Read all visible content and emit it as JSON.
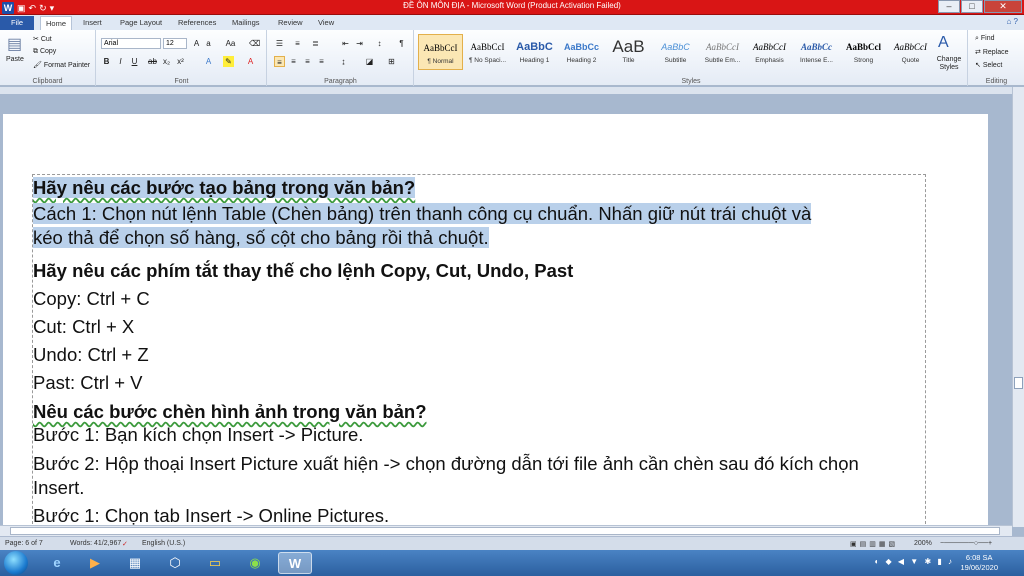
{
  "window": {
    "title": "ĐỀ ÔN MÔN ĐỊA  -  Microsoft Word (Product Activation Failed)"
  },
  "tabs": [
    "File",
    "Home",
    "Insert",
    "Page Layout",
    "References",
    "Mailings",
    "Review",
    "View"
  ],
  "ribbon": {
    "clipboard": {
      "paste": "Paste",
      "cut": "Cut",
      "copy": "Copy",
      "format_painter": "Format Painter",
      "label": "Clipboard"
    },
    "font": {
      "name": "Arial",
      "size": "12",
      "label": "Font"
    },
    "paragraph": {
      "label": "Paragraph"
    },
    "styles": {
      "label": "Styles",
      "items": [
        {
          "sample": "AaBbCcI",
          "name": "¶ Normal"
        },
        {
          "sample": "AaBbCcI",
          "name": "¶ No Spaci..."
        },
        {
          "sample": "AaBbC",
          "name": "Heading 1"
        },
        {
          "sample": "AaBbCc",
          "name": "Heading 2"
        },
        {
          "sample": "AaB",
          "name": "Title"
        },
        {
          "sample": "AaBbC",
          "name": "Subtitle"
        },
        {
          "sample": "AaBbCcI",
          "name": "Subtle Em..."
        },
        {
          "sample": "AaBbCcI",
          "name": "Emphasis"
        },
        {
          "sample": "AaBbCc",
          "name": "Intense E..."
        },
        {
          "sample": "AaBbCcl",
          "name": "Strong"
        },
        {
          "sample": "AaBbCcI",
          "name": "Quote"
        }
      ],
      "change_styles": "Change Styles"
    },
    "editing": {
      "find": "Find",
      "replace": "Replace",
      "select": "Select",
      "label": "Editing"
    }
  },
  "document": {
    "q1_title": "Hãy nêu các bước tạo bảng trong văn bản?",
    "q1_line1": "Cách 1: Chọn nút lệnh Table (Chèn bảng) trên thanh công cụ chuẩn. Nhấn giữ nút trái chuột và",
    "q1_line2": "kéo thả để chọn số hàng, số cột cho bảng rồi thả chuột.",
    "q2_title": "Hãy nêu các phím tắt thay thế cho lệnh Copy, Cut, Undo, Past",
    "copy": "Copy: Ctrl + C",
    "cut": "Cut: Ctrl + X",
    "undo": "Undo: Ctrl + Z",
    "past": "Past: Ctrl + V",
    "q3_title": "Nêu các bước chèn hình ảnh trong văn bản?",
    "step1": "Bước 1: Bạn kích chọn Insert -> Picture.",
    "step2": "Bước 2: Hộp thoại Insert Picture xuất hiện -> chọn đường dẫn tới file ảnh cần chèn sau đó kích chọn Insert.",
    "step3": "Bước 1: Chọn tab Insert -> Online Pictures."
  },
  "status": {
    "page": "Page: 6 of 7",
    "words": "Words: 41/2,967",
    "language": "English (U.S.)",
    "zoom": "200%"
  },
  "taskbar": {
    "time": "6:08 SA",
    "date": "19/06/2020"
  },
  "colors": {
    "titlebar": "#d91515",
    "selection": "#b9d0ea",
    "file_tab": "#2a5aa9"
  }
}
